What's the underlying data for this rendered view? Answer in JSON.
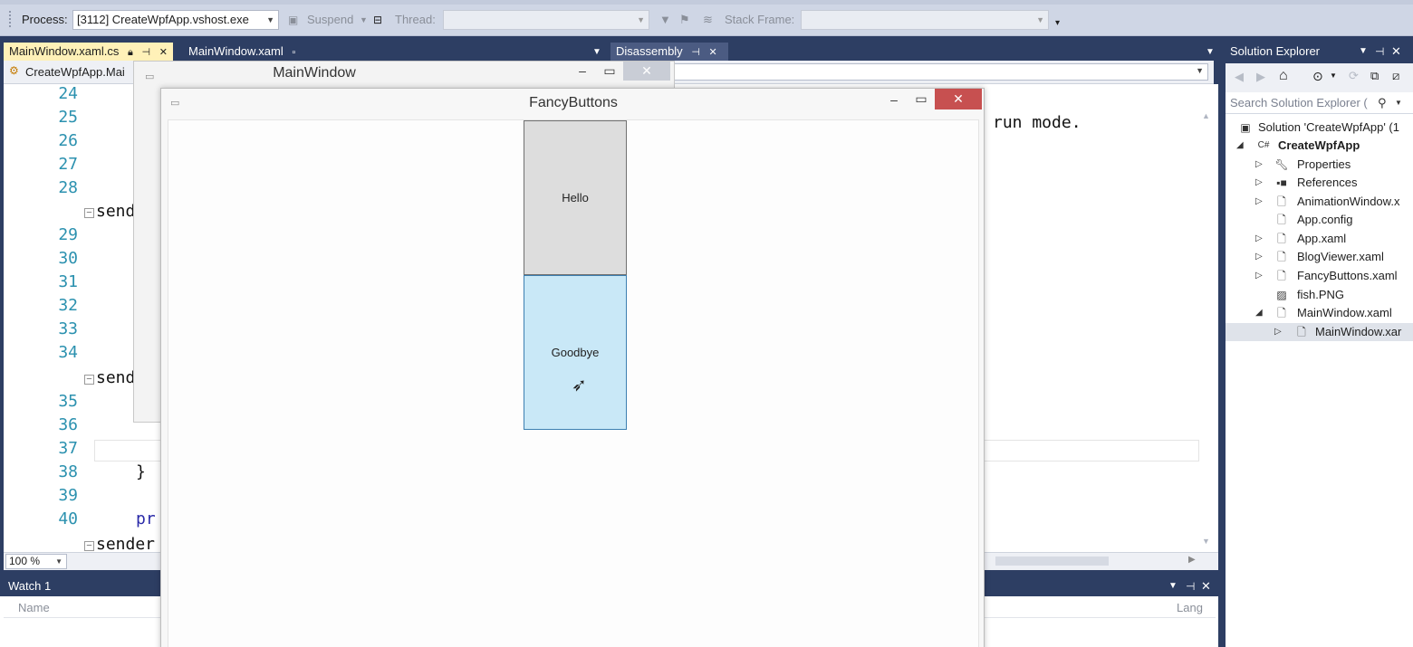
{
  "toolbar": {
    "process_label": "Process:",
    "process_value": "[3112] CreateWpfApp.vshost.exe",
    "suspend_label": "Suspend",
    "thread_label": "Thread:",
    "stack_frame_label": "Stack Frame:"
  },
  "tabs": {
    "tab1": "MainWindow.xaml.cs",
    "tab2": "MainWindow.xaml",
    "tab3": "Disassembly"
  },
  "nav": {
    "class_dropdown": "CreateWpfApp.Mai"
  },
  "editor": {
    "line_numbers": [
      "24",
      "25",
      "26",
      "27",
      "28",
      "29",
      "30",
      "31",
      "32",
      "33",
      "34",
      "35",
      "36",
      "37",
      "38",
      "39",
      "40"
    ],
    "code_sender_1": "sende",
    "code_sender_2": "sende",
    "code_brace": "}",
    "code_pr": "pr",
    "code_sender_3": "sender",
    "code_run_mode": "run mode.",
    "zoom": "100 %"
  },
  "watch": {
    "title": "Watch 1",
    "col_name": "Name",
    "col_lang": "Lang"
  },
  "solution_explorer": {
    "title": "Solution Explorer",
    "search_placeholder": "Search Solution Explorer (",
    "items": [
      {
        "label": "Solution 'CreateWpfApp' (1"
      },
      {
        "label": "CreateWpfApp"
      },
      {
        "label": "Properties"
      },
      {
        "label": "References"
      },
      {
        "label": "AnimationWindow.x"
      },
      {
        "label": "App.config"
      },
      {
        "label": "App.xaml"
      },
      {
        "label": "BlogViewer.xaml"
      },
      {
        "label": "FancyButtons.xaml"
      },
      {
        "label": "fish.PNG"
      },
      {
        "label": "MainWindow.xaml"
      },
      {
        "label": "MainWindow.xar"
      }
    ]
  },
  "windows": {
    "main_title": "MainWindow",
    "fancy_title": "FancyButtons",
    "button_hello": "Hello",
    "button_goodbye": "Goodbye"
  },
  "colors": {
    "chrome": "#2d3e63",
    "active_tab": "#fff1b8",
    "close_button": "#c75050",
    "goodbye_fill": "#c9e8f7"
  }
}
